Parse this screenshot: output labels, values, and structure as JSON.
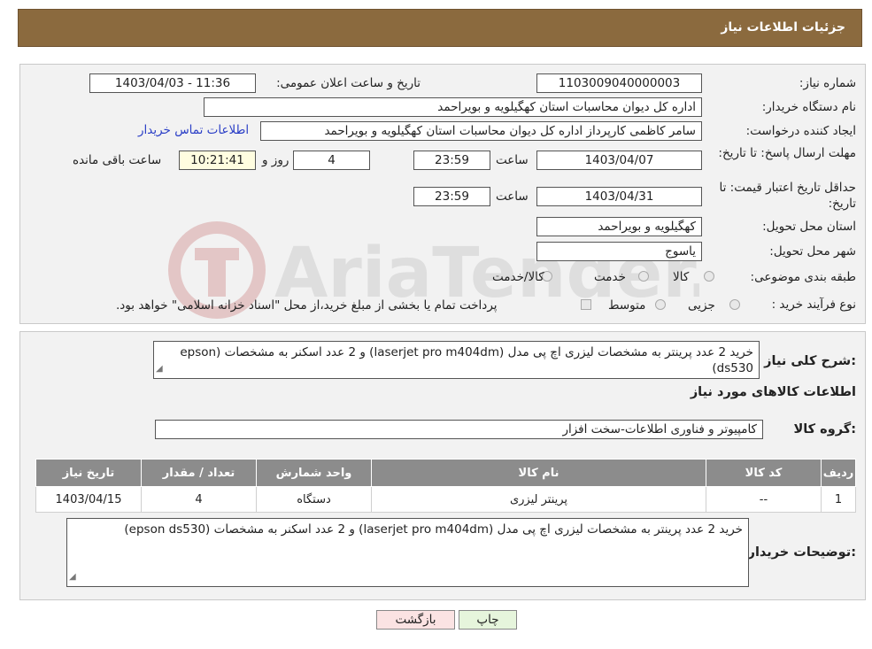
{
  "header": {
    "title": "جزئیات اطلاعات نیاز"
  },
  "form": {
    "need_number_label": "شماره نیاز:",
    "need_number": "1103009040000003",
    "announce_label": "تاریخ و ساعت اعلان عمومی:",
    "announce_value": "1403/04/03 - 11:36",
    "buyer_org_label": "نام دستگاه خریدار:",
    "buyer_org": "اداره کل دیوان محاسبات استان کهگیلویه و بویراحمد",
    "creator_label": "ایجاد کننده درخواست:",
    "creator": "سامر کاظمی کارپرداز اداره کل دیوان محاسبات استان کهگیلویه و بویراحمد",
    "contact_link": "اطلاعات تماس خریدار",
    "deadline_label": "مهلت ارسال پاسخ: تا تاریخ:",
    "deadline_date": "1403/04/07",
    "time_label": "ساعت",
    "deadline_time": "23:59",
    "days": "4",
    "days_label": "روز و",
    "remaining": "10:21:41",
    "remaining_label": "ساعت باقی مانده",
    "validity_label": "حداقل تاریخ اعتبار قیمت: تا تاریخ:",
    "validity_date": "1403/04/31",
    "validity_time": "23:59",
    "province_label": "استان محل تحویل:",
    "province": "کهگیلویه و بویراحمد",
    "city_label": "شهر محل تحویل:",
    "city": "یاسوج",
    "category_label": "طبقه بندی موضوعی:",
    "category_options": [
      "کالا",
      "خدمت",
      "کالا/خدمت"
    ],
    "purchase_label": "نوع فرآیند خرید :",
    "purchase_options": [
      "جزیی",
      "متوسط"
    ],
    "purchase_note": "پرداخت تمام یا بخشی از مبلغ خرید،از محل \"اسناد خزانه اسلامی\" خواهد بود."
  },
  "summary": {
    "desc_label": "شرح کلی نیاز:",
    "desc": "خرید 2 عدد پرینتر به مشخصات لیزری اچ پی مدل (laserjet pro m404dm) و 2 عدد اسکنر به مشخصات (epson ds530)",
    "goods_info_title": "اطلاعات کالاهای مورد نیاز",
    "group_label": "گروه کالا:",
    "group": "کامپیوتر و فناوری اطلاعات-سخت افزار",
    "table": {
      "headers": [
        "ردیف",
        "کد کالا",
        "نام کالا",
        "واحد شمارش",
        "تعداد / مقدار",
        "تاریخ نیاز"
      ],
      "rows": [
        [
          "1",
          "--",
          "پرینتر لیزری",
          "دستگاه",
          "4",
          "1403/04/15"
        ]
      ]
    },
    "buyer_notes_label": "توضیحات خریدار:",
    "buyer_notes": "خرید 2 عدد پرینتر به مشخصات لیزری اچ پی مدل (laserjet pro m404dm) و 2 عدد اسکنر به مشخصات (epson ds530)"
  },
  "buttons": {
    "back": "بازگشت",
    "print": "چاپ"
  },
  "watermark_text": "AriaTender.neT",
  "colors": {
    "header": "#8b6a3e",
    "link": "#2a3ec6",
    "back_button": "#fbe3e3",
    "print_button": "#e6f5dc"
  }
}
